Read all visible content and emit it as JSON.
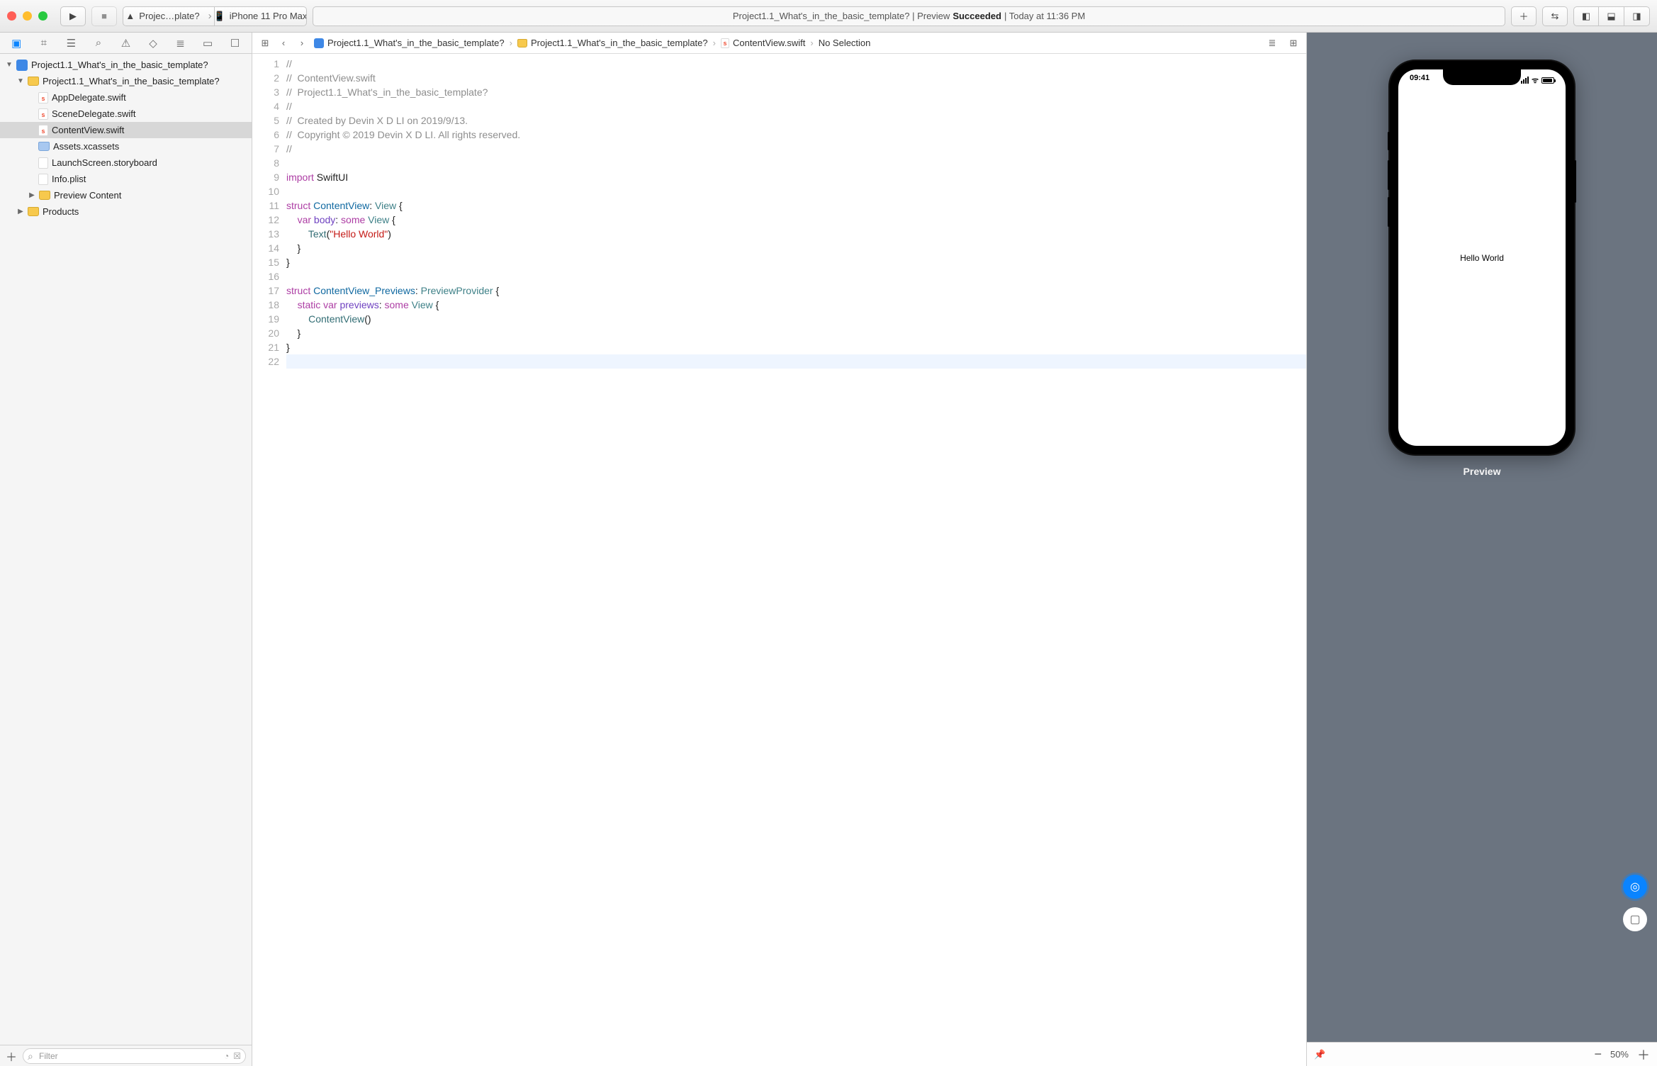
{
  "toolbar": {
    "scheme": {
      "project": "Projec…plate?",
      "device": "iPhone 11 Pro Max"
    },
    "status": {
      "prefix": "Project1.1_What's_in_the_basic_template? | Preview ",
      "state": "Succeeded",
      "suffix": " | Today at 11:36 PM"
    }
  },
  "navigator": {
    "filter_placeholder": "Filter",
    "tree": {
      "root": "Project1.1_What's_in_the_basic_template?",
      "group": "Project1.1_What's_in_the_basic_template?",
      "files": [
        "AppDelegate.swift",
        "SceneDelegate.swift",
        "ContentView.swift",
        "Assets.xcassets",
        "LaunchScreen.storyboard",
        "Info.plist"
      ],
      "preview_content": "Preview Content",
      "products": "Products"
    }
  },
  "jumpbar": {
    "seg1": "Project1.1_What's_in_the_basic_template?",
    "seg2": "Project1.1_What's_in_the_basic_template?",
    "seg3": "ContentView.swift",
    "seg4": "No Selection"
  },
  "code": {
    "lines": [
      {
        "n": 1,
        "kind": "cmt",
        "t": "//"
      },
      {
        "n": 2,
        "kind": "cmt",
        "t": "//  ContentView.swift"
      },
      {
        "n": 3,
        "kind": "cmt",
        "t": "//  Project1.1_What's_in_the_basic_template?"
      },
      {
        "n": 4,
        "kind": "cmt",
        "t": "//"
      },
      {
        "n": 5,
        "kind": "cmt",
        "t": "//  Created by Devin X D LI on 2019/9/13."
      },
      {
        "n": 6,
        "kind": "cmt",
        "t": "//  Copyright © 2019 Devin X D LI. All rights reserved."
      },
      {
        "n": 7,
        "kind": "cmt",
        "t": "//"
      },
      {
        "n": 8,
        "kind": "blank",
        "t": ""
      },
      {
        "n": 9,
        "kind": "import",
        "kw": "import",
        "mod": "SwiftUI"
      },
      {
        "n": 10,
        "kind": "blank",
        "t": ""
      },
      {
        "n": 11,
        "kind": "struct-open",
        "kw": "struct",
        "name": "ContentView",
        "proto": "View"
      },
      {
        "n": 12,
        "kind": "var-body",
        "kw1": "var",
        "id": "body",
        "kw2": "some",
        "type": "View"
      },
      {
        "n": 13,
        "kind": "text-call",
        "fn": "Text",
        "str": "\"Hello World\""
      },
      {
        "n": 14,
        "kind": "close1"
      },
      {
        "n": 15,
        "kind": "close0"
      },
      {
        "n": 16,
        "kind": "blank",
        "t": ""
      },
      {
        "n": 17,
        "kind": "struct-open",
        "kw": "struct",
        "name": "ContentView_Previews",
        "proto": "PreviewProvider"
      },
      {
        "n": 18,
        "kind": "static-var",
        "kw0": "static",
        "kw1": "var",
        "id": "previews",
        "kw2": "some",
        "type": "View"
      },
      {
        "n": 19,
        "kind": "call",
        "fn": "ContentView"
      },
      {
        "n": 20,
        "kind": "close1"
      },
      {
        "n": 21,
        "kind": "close0"
      },
      {
        "n": 22,
        "kind": "cursor",
        "t": ""
      }
    ]
  },
  "preview": {
    "status_time": "09:41",
    "content_text": "Hello World",
    "label": "Preview",
    "zoom": "50%"
  }
}
